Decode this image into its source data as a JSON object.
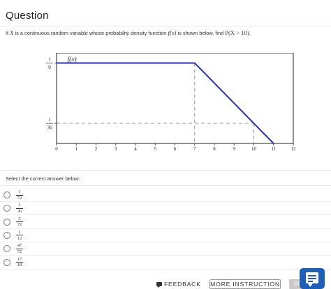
{
  "header": {
    "title": "Question"
  },
  "question": {
    "pre": "If ",
    "var": "X",
    "mid": " is a continuous random variable whose probability density function ",
    "fx": "f(x)",
    "post": " is shown below, find ",
    "prob": "P(X > 10)",
    "end": "."
  },
  "chart_data": {
    "type": "line",
    "function_label": "f(x)",
    "x_ticks": [
      "0",
      "1",
      "2",
      "3",
      "4",
      "5",
      "6",
      "7",
      "8",
      "9",
      "10",
      "11",
      "12"
    ],
    "xlim": [
      0,
      12
    ],
    "y_ticks": [
      {
        "num": "1",
        "den": "9",
        "value": 0.1111
      },
      {
        "num": "1",
        "den": "36",
        "value": 0.0278
      }
    ],
    "ylim": [
      0,
      0.125
    ],
    "series": [
      {
        "x": [
          0,
          7,
          11
        ],
        "y": [
          0.1111,
          0.1111,
          0
        ]
      }
    ],
    "guides": [
      {
        "type": "vertical",
        "x": 7,
        "y_to": 0.1111
      },
      {
        "type": "vertical",
        "x": 10,
        "y_to": 0.0278
      },
      {
        "type": "horizontal",
        "y": 0.0278,
        "x_to": 10
      }
    ],
    "colors": {
      "line": "#2a2fb3",
      "guide": "#888888"
    }
  },
  "prompt": {
    "select_label": "Select the correct answer below:"
  },
  "options": [
    {
      "num": "1",
      "den": "72"
    },
    {
      "num": "1",
      "den": "36"
    },
    {
      "num": "5",
      "den": "72"
    },
    {
      "num": "1",
      "den": "12"
    },
    {
      "num": "47",
      "den": "72"
    },
    {
      "num": "17",
      "den": "18"
    }
  ],
  "footer": {
    "feedback_label": "FEEDBACK",
    "more_instruction_label": "MORE INSTRUCTION",
    "submit_label": "SU"
  },
  "icons": {
    "feedback": "comment-icon",
    "chat": "chat-icon"
  }
}
